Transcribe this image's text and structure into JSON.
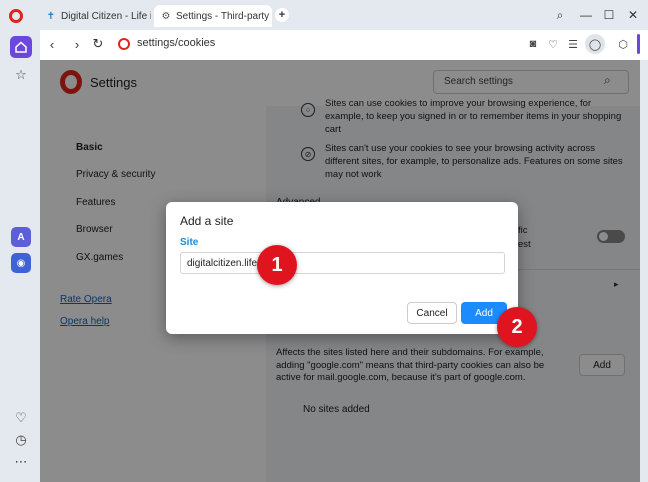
{
  "tabs": [
    {
      "title": "Digital Citizen - Life in a d",
      "icon": "digital-citizen-icon"
    },
    {
      "title": "Settings - Third-party coo",
      "icon": "gear-icon",
      "close": "✕"
    }
  ],
  "url": "settings/cookies",
  "settings_title": "Settings",
  "search_placeholder": "Search settings",
  "nav": {
    "items": [
      "Basic",
      "Privacy & security",
      "Features",
      "Browser",
      "GX.games"
    ],
    "links": [
      "Rate Opera",
      "Opera help"
    ]
  },
  "main": {
    "row1_text": "Sites can use cookies to improve your browsing experience, for example, to keep you signed in or to remember items in your shopping cart",
    "row2_text": "Sites can't use your cookies to see your browsing activity across different sites, for example, to personalize ads. Features on some sites may not work",
    "advanced_label": "Advanced",
    "frag_fic": "fic",
    "frag_est": "est",
    "description": "Affects the sites listed here and their subdomains. For example, adding \"google.com\" means that third-party cookies can also be active for mail.google.com, because it's part of google.com.",
    "add_label": "Add",
    "no_sites": "No sites added"
  },
  "dialog": {
    "title": "Add a site",
    "site_label": "Site",
    "site_value": "digitalcitizen.life",
    "cancel_label": "Cancel",
    "add_label": "Add"
  },
  "callouts": [
    "1",
    "2"
  ],
  "colors": {
    "accent": "#6b47dc",
    "opera_red": "#e2231a",
    "primary_button": "#1a8cff",
    "callout": "#e0141e",
    "link": "#1565c0"
  }
}
